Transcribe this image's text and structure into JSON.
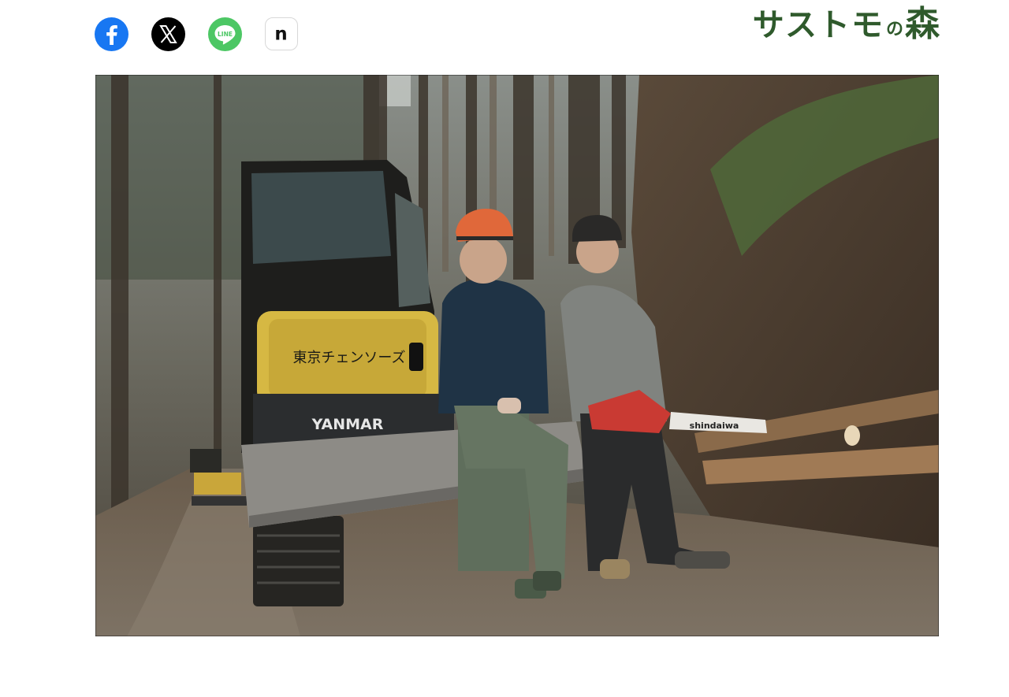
{
  "share": {
    "items": [
      {
        "name": "facebook",
        "icon": "facebook-icon",
        "color": "#1877f2"
      },
      {
        "name": "x",
        "icon": "x-icon",
        "color": "#000000"
      },
      {
        "name": "line",
        "icon": "line-icon",
        "color": "#4cc764",
        "label": "LINE"
      },
      {
        "name": "note",
        "icon": "note-icon",
        "color": "#ffffff",
        "label": "n"
      }
    ]
  },
  "logo": {
    "main": "サストモ",
    "particle": "の",
    "mori": "森",
    "color": "#2f5a2c"
  },
  "photo": {
    "excavator_text": "東京チェンソーズ",
    "excavator_brand": "YANMAR",
    "chainsaw_brand": "shindaiwa"
  }
}
